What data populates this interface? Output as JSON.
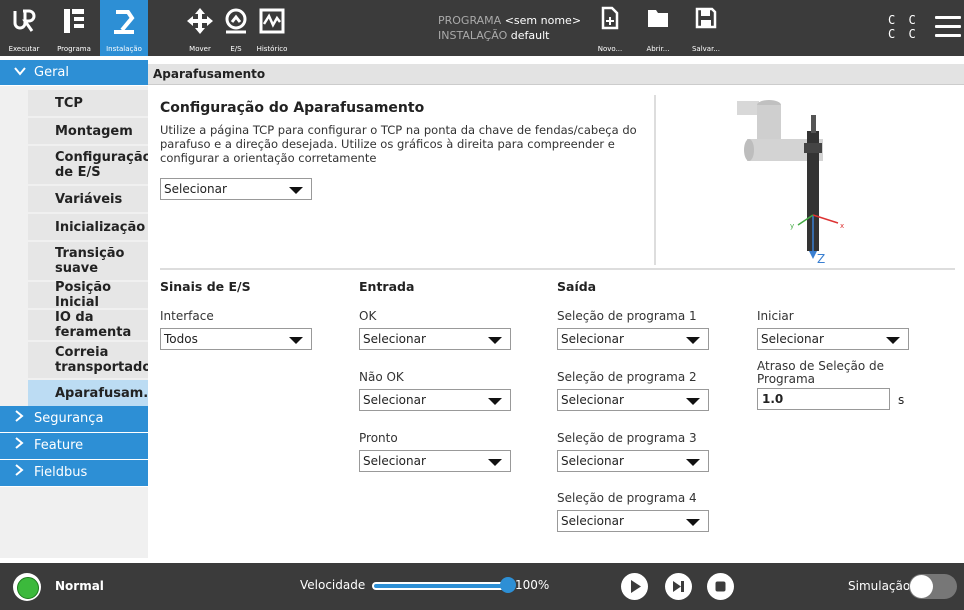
{
  "topbar": {
    "tabs": [
      {
        "label": "Executar",
        "icon": "ur-logo-icon"
      },
      {
        "label": "Programa",
        "icon": "program-icon"
      },
      {
        "label": "Instalação",
        "icon": "installation-icon"
      },
      {
        "label": "Mover",
        "icon": "move-icon"
      },
      {
        "label": "E/S",
        "icon": "io-icon"
      },
      {
        "label": "Histórico",
        "icon": "history-icon"
      }
    ],
    "programa_label": "PROGRAMA",
    "programa_value": "<sem nome>",
    "instalacao_label": "INSTALAÇÃO",
    "instalacao_value": "default",
    "file_buttons": [
      "Novo...",
      "Abrir...",
      "Salvar..."
    ],
    "cc_line1": "C C",
    "cc_line2": "C C"
  },
  "sidebar": {
    "group_geral": "Geral",
    "items": [
      "TCP",
      "Montagem",
      "Configuração de E/S",
      "Variáveis",
      "Inicialização",
      "Transição suave",
      "Posição Inicial",
      "IO da feramenta",
      "Correia transportadora",
      "Aparafusam..."
    ],
    "groups_collapsed": [
      "Segurança",
      "Feature",
      "Fieldbus"
    ]
  },
  "content": {
    "breadcrumb": "Aparafusamento",
    "title": "Configuração do Aparafusamento",
    "description": "Utilize a página TCP para configurar o TCP na ponta da chave de fendas/cabeça do parafuso e a direção desejada. Utilize os gráficos à direita para compreender e configurar a orientação corretamente",
    "config_select": "Selecionar",
    "diagram": {
      "axis_x": "x",
      "axis_y": "y",
      "axis_z": "Z"
    },
    "io": {
      "heading": "Sinais de E/S",
      "interface_label": "Interface",
      "interface_value": "Todos"
    },
    "entrada": {
      "heading": "Entrada",
      "ok_label": "OK",
      "ok_value": "Selecionar",
      "nao_ok_label": "Não OK",
      "nao_ok_value": "Selecionar",
      "pronto_label": "Pronto",
      "pronto_value": "Selecionar"
    },
    "saida": {
      "heading": "Saída",
      "sel1_label": "Seleção de programa 1",
      "sel1_value": "Selecionar",
      "sel2_label": "Seleção de programa 2",
      "sel2_value": "Selecionar",
      "sel3_label": "Seleção de programa 3",
      "sel3_value": "Selecionar",
      "sel4_label": "Seleção de programa 4",
      "sel4_value": "Selecionar",
      "iniciar_label": "Iniciar",
      "iniciar_value": "Selecionar",
      "atraso_label": "Atraso de Seleção de Programa",
      "atraso_value": "1.0",
      "atraso_unit": "s"
    }
  },
  "bottombar": {
    "status": "Normal",
    "speed_label": "Velocidade",
    "speed_value": "100%",
    "speed_fraction": 1.0,
    "sim_label": "Simulação"
  },
  "colors": {
    "accent": "#2d8fd5",
    "bar": "#3b3b3b",
    "status_ok": "#3cb93c",
    "selected": "#bcdcf3"
  }
}
